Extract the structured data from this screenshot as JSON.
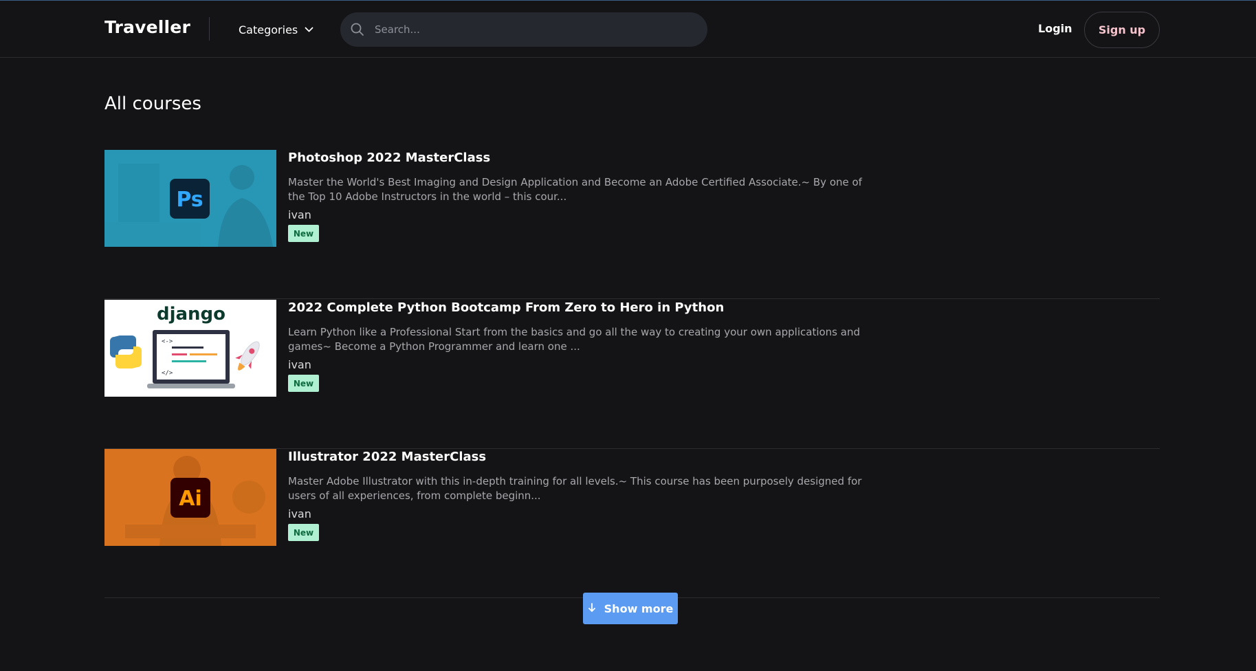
{
  "navbar": {
    "brand": "Traveller",
    "categories_label": "Categories",
    "search_placeholder": "Search...",
    "login_label": "Login",
    "signup_label": "Sign up"
  },
  "main": {
    "title": "All courses",
    "courses": [
      {
        "title": "Photoshop 2022 MasterClass",
        "description": "Master the World's Best Imaging and Design Application and Become an Adobe Certified Associate.~ By one of the Top 10 Adobe Instructors in the world – this cour...",
        "author": "ivan",
        "badge": "New",
        "thumb_logo": "Ps",
        "thumb_color": "#2c9fbd"
      },
      {
        "title": "2022 Complete Python Bootcamp From Zero to Hero in Python",
        "description": "Learn Python like a Professional Start from the basics and go all the way to creating your own applications and games~ Become a Python Programmer and learn one ...",
        "author": "ivan",
        "badge": "New",
        "thumb_logo": "django",
        "thumb_color": "#ffffff"
      },
      {
        "title": "Illustrator 2022 MasterClass",
        "description": "Master Adobe Illustrator with this in-depth training for all levels.~ This course has been purposely designed for users of all experiences, from complete beginn...",
        "author": "ivan",
        "badge": "New",
        "thumb_logo": "Ai",
        "thumb_color": "#d9731f"
      }
    ],
    "show_more_label": "Show more"
  },
  "colors": {
    "background": "#141416",
    "accent_button": "#5b9cf2",
    "badge_bg": "#aef0d1",
    "badge_text": "#0d6b3f",
    "signup_text": "#f5c4cd"
  },
  "icons": {
    "search": "search-icon",
    "categories_chevron": "chevron-down-icon",
    "show_more": "arrow-down-icon"
  }
}
